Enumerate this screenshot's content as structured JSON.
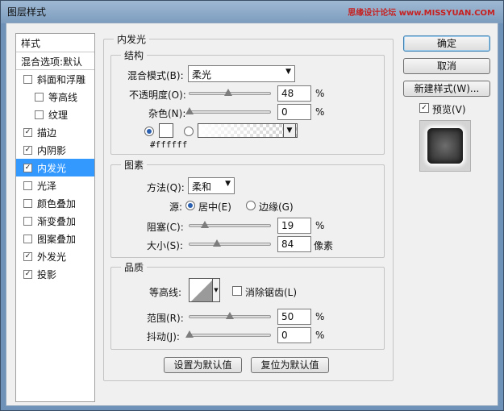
{
  "window": {
    "title": "图层样式",
    "watermark": "思缘设计论坛 www.MISSYUAN.COM"
  },
  "style_list": {
    "header": "样式",
    "blend_options": "混合选项:默认",
    "items": [
      {
        "label": "斜面和浮雕",
        "checked": false,
        "sub": false
      },
      {
        "label": "等高线",
        "checked": false,
        "sub": true
      },
      {
        "label": "纹理",
        "checked": false,
        "sub": true
      },
      {
        "label": "描边",
        "checked": true,
        "sub": false
      },
      {
        "label": "内阴影",
        "checked": true,
        "sub": false
      },
      {
        "label": "内发光",
        "checked": true,
        "sub": false,
        "selected": true
      },
      {
        "label": "光泽",
        "checked": false,
        "sub": false
      },
      {
        "label": "颜色叠加",
        "checked": false,
        "sub": false
      },
      {
        "label": "渐变叠加",
        "checked": false,
        "sub": false
      },
      {
        "label": "图案叠加",
        "checked": false,
        "sub": false
      },
      {
        "label": "外发光",
        "checked": true,
        "sub": false
      },
      {
        "label": "投影",
        "checked": true,
        "sub": false
      }
    ]
  },
  "panel": {
    "title": "内发光",
    "structure": {
      "title": "结构",
      "blend_mode_label": "混合模式(B):",
      "blend_mode_value": "柔光",
      "opacity_label": "不透明度(O):",
      "opacity_value": "48",
      "opacity_unit": "%",
      "opacity_level": 48,
      "noise_label": "杂色(N):",
      "noise_value": "0",
      "noise_unit": "%",
      "noise_level": 0,
      "color_hex": "#ffffff",
      "color_radio_selected": "color"
    },
    "elements": {
      "title": "图素",
      "technique_label": "方法(Q):",
      "technique_value": "柔和",
      "source_label": "源:",
      "source_center": "居中(E)",
      "source_edge": "边缘(G)",
      "source_selected": "center",
      "choke_label": "阻塞(C):",
      "choke_value": "19",
      "choke_unit": "%",
      "choke_level": 19,
      "size_label": "大小(S):",
      "size_value": "84",
      "size_unit": "像素",
      "size_level": 84,
      "size_max": 250
    },
    "quality": {
      "title": "品质",
      "contour_label": "等高线:",
      "antialias_label": "消除锯齿(L)",
      "antialias_checked": false,
      "range_label": "范围(R):",
      "range_value": "50",
      "range_unit": "%",
      "range_level": 50,
      "jitter_label": "抖动(J):",
      "jitter_value": "0",
      "jitter_unit": "%",
      "jitter_level": 0
    },
    "make_default": "设置为默认值",
    "reset_default": "复位为默认值"
  },
  "buttons": {
    "ok": "确定",
    "cancel": "取消",
    "new_style": "新建样式(W)...",
    "preview_label": "预览(V)",
    "preview_checked": true
  }
}
